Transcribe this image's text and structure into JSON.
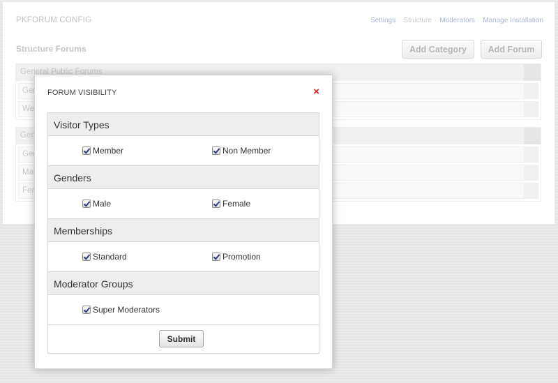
{
  "app": {
    "title": "PKFORUM CONFIG"
  },
  "nav": {
    "items": [
      {
        "label": "Settings"
      },
      {
        "label": "Structure"
      },
      {
        "label": "Moderators"
      },
      {
        "label": "Manage Installation"
      }
    ]
  },
  "structure": {
    "title": "Structure Forums",
    "add_category_label": "Add Category",
    "add_forum_label": "Add Forum",
    "categories": [
      {
        "name": "General Public Forums",
        "forums": [
          "Gen",
          "We"
        ]
      },
      {
        "name": "Gen",
        "forums": [
          "Gen",
          "Mal",
          "Fer"
        ]
      }
    ]
  },
  "modal": {
    "title": "FORUM VISIBILITY",
    "close_symbol": "×",
    "submit_label": "Submit",
    "groups": [
      {
        "name": "Visitor Types",
        "options": [
          {
            "label": "Member",
            "checked": true
          },
          {
            "label": "Non Member",
            "checked": true
          }
        ]
      },
      {
        "name": "Genders",
        "options": [
          {
            "label": "Male",
            "checked": true
          },
          {
            "label": "Female",
            "checked": true
          }
        ]
      },
      {
        "name": "Memberships",
        "options": [
          {
            "label": "Standard",
            "checked": true
          },
          {
            "label": "Promotion",
            "checked": true
          }
        ]
      },
      {
        "name": "Moderator Groups",
        "options": [
          {
            "label": "Super Moderators",
            "checked": true
          }
        ]
      }
    ]
  },
  "colors": {
    "close": "#d01d1d",
    "nav_link": "#a9b7d6",
    "group_header_bg": "#eeeeee"
  }
}
